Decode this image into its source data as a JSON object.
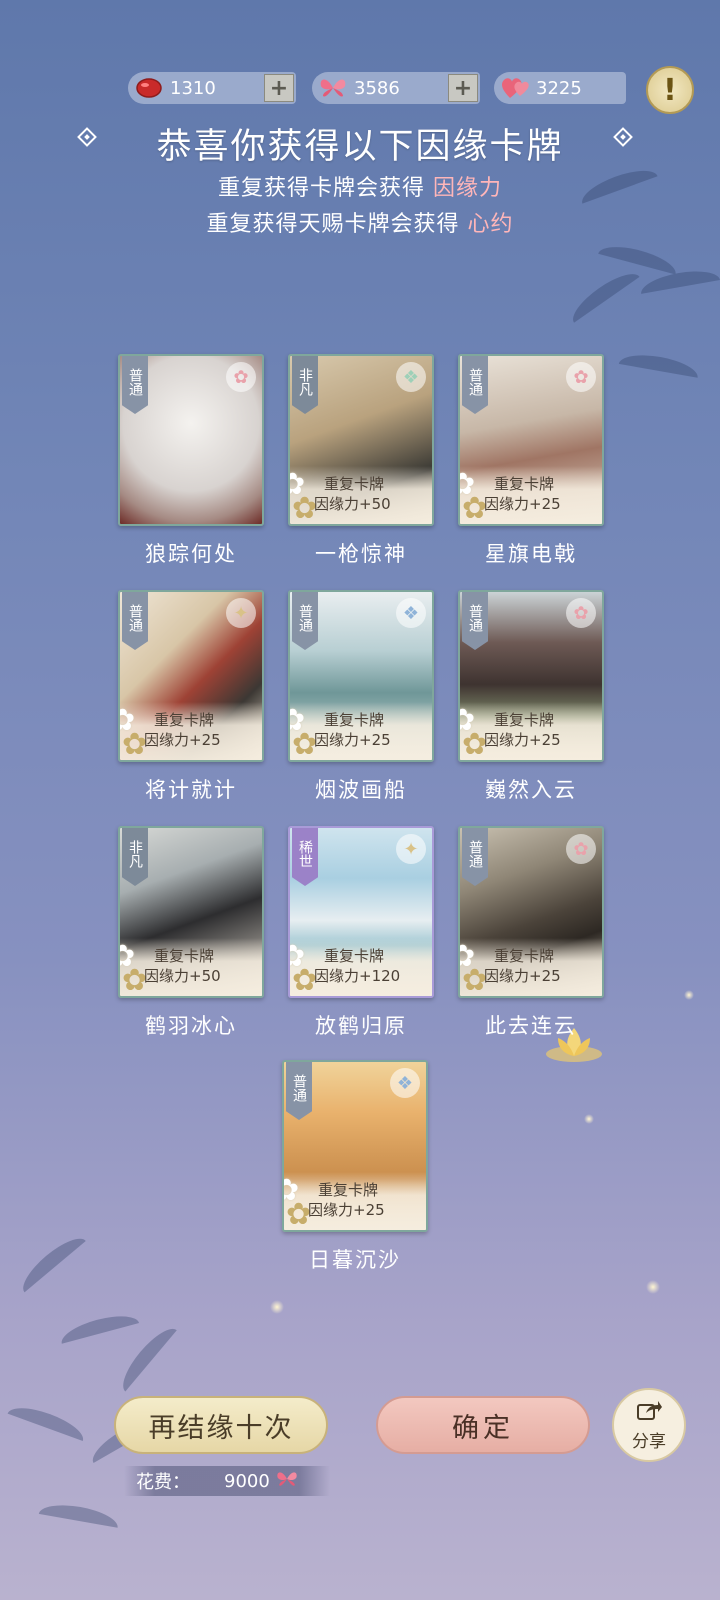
{
  "currency": {
    "jade": {
      "value": "1310",
      "icon": "red-gem-icon"
    },
    "butterfly": {
      "value": "3586",
      "icon": "butterfly-icon"
    },
    "hearts": {
      "value": "3225",
      "icon": "hearts-icon"
    },
    "plus_label": "+"
  },
  "info_button": {
    "label": "!"
  },
  "header": {
    "title": "恭喜你获得以下因缘卡牌",
    "line1_prefix": "重复获得卡牌会获得",
    "line1_highlight": "因缘力",
    "line2_prefix": "重复获得天赐卡牌会获得",
    "line2_highlight": "心约"
  },
  "duplicate_label": "重复卡牌",
  "cards": [
    {
      "name": "狼踪何处",
      "rarity": "普通",
      "duplicate": false,
      "bonus": ""
    },
    {
      "name": "一枪惊神",
      "rarity": "非凡",
      "duplicate": true,
      "bonus": "因缘力+50"
    },
    {
      "name": "星旗电戟",
      "rarity": "普通",
      "duplicate": true,
      "bonus": "因缘力+25"
    },
    {
      "name": "将计就计",
      "rarity": "普通",
      "duplicate": true,
      "bonus": "因缘力+25"
    },
    {
      "name": "烟波画船",
      "rarity": "普通",
      "duplicate": true,
      "bonus": "因缘力+25"
    },
    {
      "name": "巍然入云",
      "rarity": "普通",
      "duplicate": true,
      "bonus": "因缘力+25"
    },
    {
      "name": "鹤羽冰心",
      "rarity": "非凡",
      "duplicate": true,
      "bonus": "因缘力+50"
    },
    {
      "name": "放鹤归原",
      "rarity": "稀世",
      "duplicate": true,
      "bonus": "因缘力+120"
    },
    {
      "name": "此去连云",
      "rarity": "普通",
      "duplicate": true,
      "bonus": "因缘力+25"
    },
    {
      "name": "日暮沉沙",
      "rarity": "普通",
      "duplicate": true,
      "bonus": "因缘力+25"
    }
  ],
  "footer": {
    "again_label": "再结缘十次",
    "ok_label": "确定",
    "share_label": "分享",
    "cost_label": "花费：",
    "cost_value": "9000"
  },
  "colors": {
    "highlight": "#ffb6b9",
    "accent_gold": "#e6d7a6",
    "accent_pink": "#e6aea4"
  }
}
